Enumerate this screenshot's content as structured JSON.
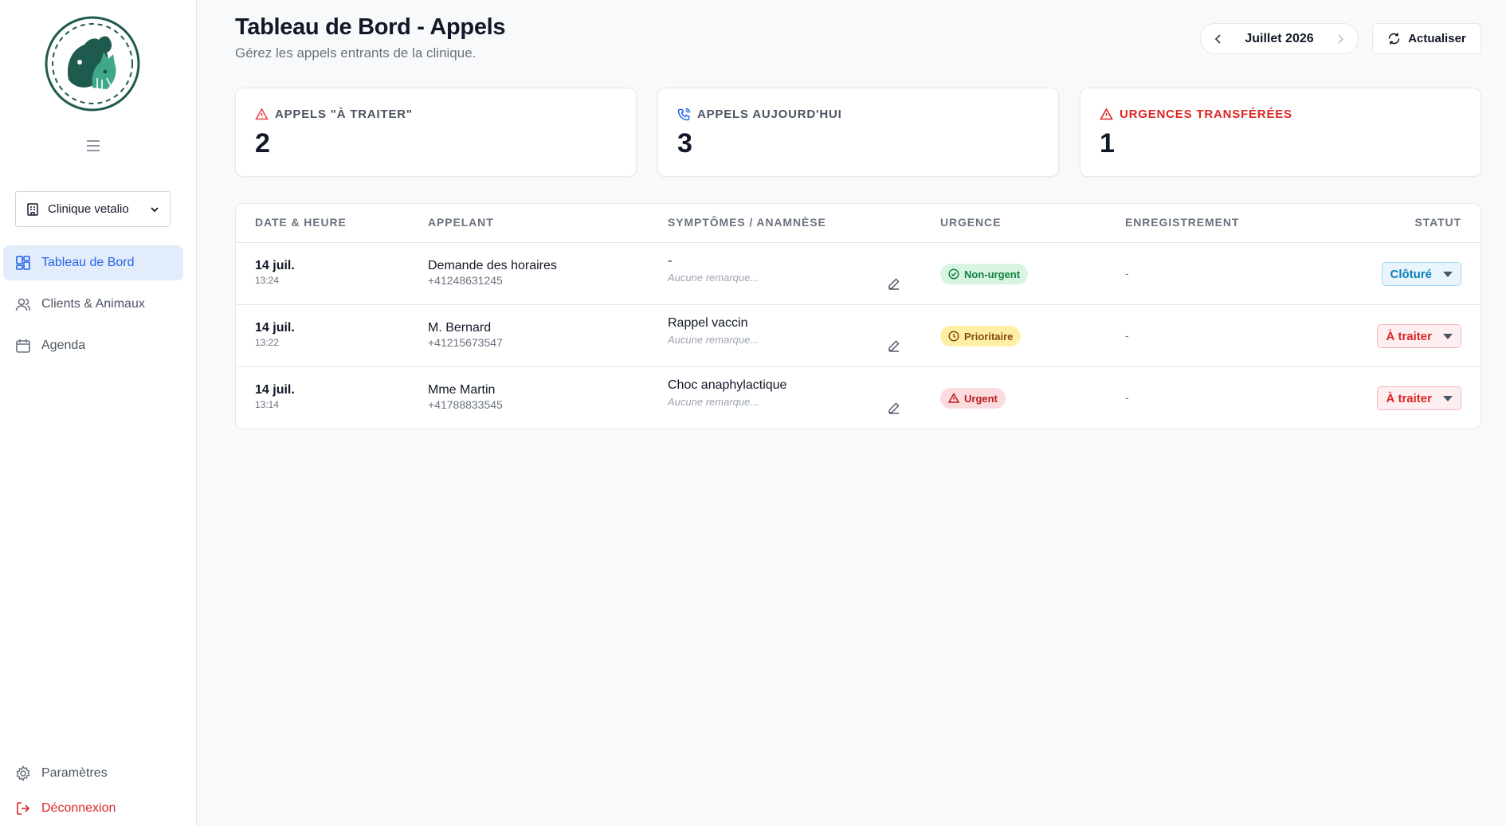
{
  "sidebar": {
    "clinic_select": "Clinique vetalio",
    "nav": [
      {
        "label": "Tableau de Bord",
        "icon": "dashboard-icon",
        "active": true
      },
      {
        "label": "Clients & Animaux",
        "icon": "users-icon"
      },
      {
        "label": "Agenda",
        "icon": "calendar-icon"
      }
    ],
    "bottom": [
      {
        "label": "Paramètres",
        "icon": "gear-icon"
      },
      {
        "label": "Déconnexion",
        "icon": "logout-icon"
      }
    ]
  },
  "header": {
    "title": "Tableau de Bord - Appels",
    "subtitle": "Gérez les appels entrants de la clinique.",
    "month": "Juillet 2026",
    "refresh_label": "Actualiser"
  },
  "stats": [
    {
      "label": "APPELS \"À TRAITER\"",
      "value": "2",
      "color": "#ef4444",
      "icon": "warning-triangle-icon"
    },
    {
      "label": "APPELS AUJOURD'HUI",
      "value": "3",
      "color": "#2563eb",
      "icon": "phone-call-icon"
    },
    {
      "label": "URGENCES TRANSFÉRÉES",
      "value": "1",
      "color": "#dc2626",
      "icon": "warning-triangle-icon"
    }
  ],
  "table": {
    "columns": [
      "DATE & HEURE",
      "APPELANT",
      "SYMPTÔMES / ANAMNÈSE",
      "URGENCE",
      "ENREGISTREMENT",
      "STATUT"
    ],
    "rows": [
      {
        "date": "14 juil.",
        "time": "13:24",
        "caller": "Demande des horaires",
        "phone": "+41248631245",
        "symptom": "-",
        "remark": "Aucune remarque...",
        "urgency": "Non-urgent",
        "urgency_type": "low",
        "recording": "-",
        "status": "Clôturé",
        "status_type": "closed"
      },
      {
        "date": "14 juil.",
        "time": "13:22",
        "caller": "M. Bernard",
        "phone": "+41215673547",
        "symptom": "Rappel vaccin",
        "remark": "Aucune remarque...",
        "urgency": "Prioritaire",
        "urgency_type": "medium",
        "recording": "-",
        "status": "À traiter",
        "status_type": "todo"
      },
      {
        "date": "14 juil.",
        "time": "13:14",
        "caller": "Mme Martin",
        "phone": "+41788833545",
        "symptom": "Choc anaphylactique",
        "remark": "Aucune remarque...",
        "urgency": "Urgent",
        "urgency_type": "high",
        "recording": "-",
        "status": "À traiter",
        "status_type": "todo"
      }
    ]
  },
  "colors": {
    "accent": "#2563eb",
    "danger": "#dc2626",
    "logo": "#1f5a4f"
  }
}
